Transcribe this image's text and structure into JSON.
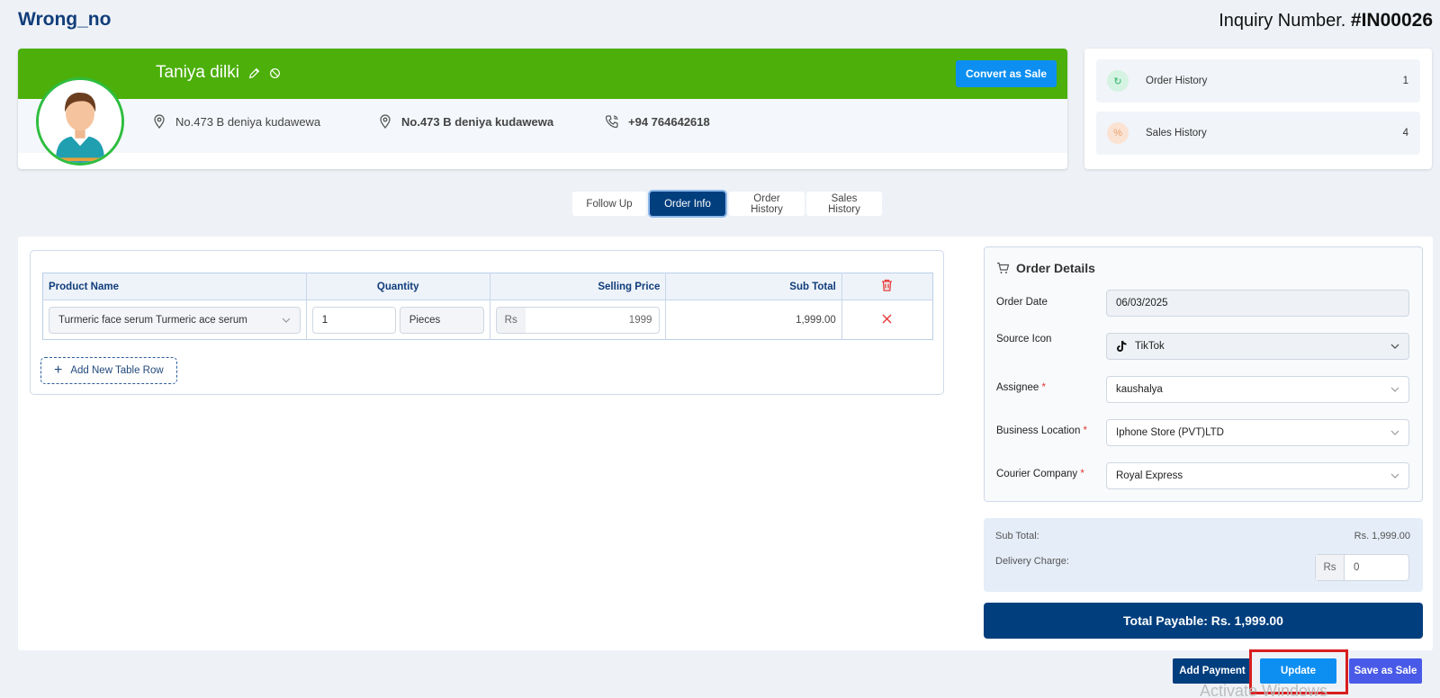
{
  "page_title": "Wrong_no",
  "inquiry": {
    "label": "Inquiry Number.",
    "number": "#IN00026"
  },
  "customer": {
    "name": "Taniya dilki",
    "address1": "No.473 B deniya kudawewa",
    "address2": "No.473 B deniya kudawewa",
    "phone": "+94 764642618",
    "convert_label": "Convert as Sale"
  },
  "history": [
    {
      "label": "Order History",
      "count": "1"
    },
    {
      "label": "Sales History",
      "count": "4"
    }
  ],
  "tabs": [
    {
      "label": "Follow Up"
    },
    {
      "label": "Order Info"
    },
    {
      "label": "Order History"
    },
    {
      "label": "Sales History"
    }
  ],
  "product_table": {
    "headers": {
      "product": "Product Name",
      "quantity": "Quantity",
      "price": "Selling Price",
      "subtotal": "Sub Total"
    },
    "row": {
      "product": "Turmeric face serum Turmeric ace serum",
      "qty": "1",
      "unit": "Pieces",
      "currency": "Rs",
      "price": "1999",
      "subtotal": "1,999.00"
    },
    "add_row_label": "Add New Table Row"
  },
  "order_details": {
    "title": "Order Details",
    "order_date_label": "Order Date",
    "order_date": "06/03/2025",
    "source_label": "Source Icon",
    "source": "TikTok",
    "assignee_label": "Assignee",
    "assignee": "kaushalya",
    "location_label": "Business Location",
    "location": "Iphone Store (PVT)LTD",
    "courier_label": "Courier Company",
    "courier": "Royal Express",
    "required_mark": "*"
  },
  "summary": {
    "subtotal_label": "Sub Total:",
    "subtotal": "Rs. 1,999.00",
    "delivery_label": "Delivery Charge:",
    "delivery_currency": "Rs",
    "delivery_value": "0",
    "total": "Total Payable: Rs. 1,999.00"
  },
  "actions": {
    "add_payment": "Add Payment",
    "update": "Update",
    "save_as_sale": "Save as Sale"
  },
  "watermark": "Activate Windows",
  "colors": {
    "brand_dark": "#003e7e",
    "brand_green": "#4caf0a",
    "accent_blue": "#0d8ff2",
    "save_purple": "#4a5ae8",
    "highlight_red": "#d81e1e"
  }
}
